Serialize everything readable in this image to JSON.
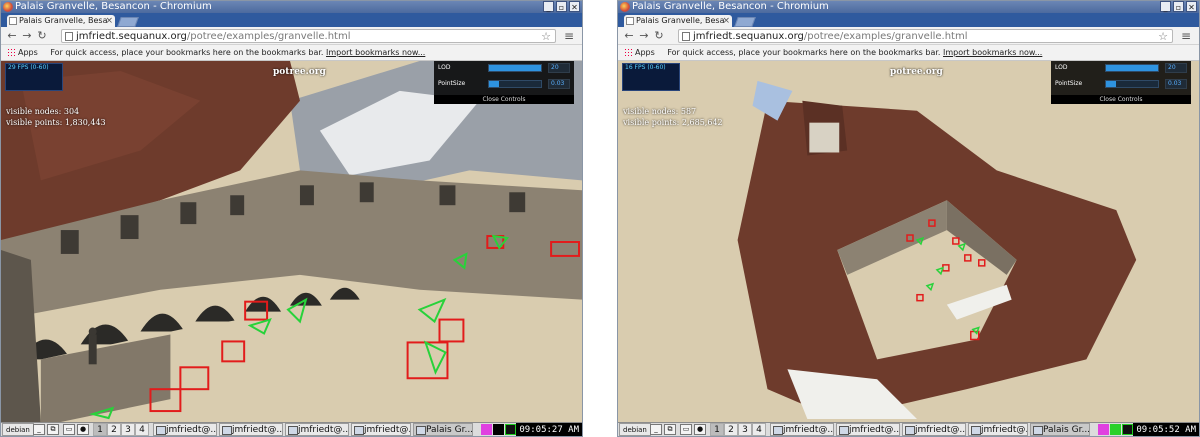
{
  "colors": {
    "titlebar": "#4c6a9e",
    "tabstrip": "#2f5a9e",
    "sky": "#d9ccaf",
    "roof": "#6e3b2c",
    "wall": "#8c8272",
    "frustum_red": "#e21b1b",
    "frustum_green": "#28d23a",
    "slider_fill": "#2e93e0"
  },
  "left": {
    "window_title": "Palais Granvelle, Besancon - Chromium",
    "tab_title": "Palais Granvelle, Besa",
    "url_host": "jmfriedt.sequanux.org",
    "url_path": "/potree/examples/granvelle.html",
    "bookmarks": {
      "apps": "Apps",
      "hint": "For quick access, place your bookmarks here on the bookmarks bar.",
      "import": "Import bookmarks now..."
    },
    "fps": "29 FPS (0-60)",
    "brand": "potree.org",
    "visible_nodes": "visible nodes: 304",
    "visible_points": "visible points: 1,830,443",
    "controls": {
      "lod_label": "LOD",
      "lod_value": "20",
      "lod_level": 1.0,
      "pointsize_label": "PointSize",
      "pointsize_value": "0.03",
      "pointsize_level": 0.2,
      "close": "Close Controls"
    },
    "taskbar": {
      "start": "debian",
      "ws": [
        "1",
        "2",
        "3",
        "4"
      ],
      "tasks": [
        "jmfriedt@...",
        "jmfriedt@...",
        "jmfriedt@...",
        "jmfriedt@...",
        "Palais Gr..."
      ],
      "clock": "09:05:27 AM"
    }
  },
  "right": {
    "window_title": "Palais Granvelle, Besancon - Chromium",
    "tab_title": "Palais Granvelle, Besa",
    "url_host": "jmfriedt.sequanux.org",
    "url_path": "/potree/examples/granvelle.html",
    "bookmarks": {
      "apps": "Apps",
      "hint": "For quick access, place your bookmarks here on the bookmarks bar.",
      "import": "Import bookmarks now..."
    },
    "fps": "16 FPS (0-60)",
    "brand": "potree.org",
    "visible_nodes": "visible nodes: 587",
    "visible_points": "visible points: 2,685,642",
    "controls": {
      "lod_label": "LOD",
      "lod_value": "20",
      "lod_level": 1.0,
      "pointsize_label": "PointSize",
      "pointsize_value": "0.03",
      "pointsize_level": 0.2,
      "close": "Close Controls"
    },
    "taskbar": {
      "start": "debian",
      "ws": [
        "1",
        "2",
        "3",
        "4"
      ],
      "tasks": [
        "jmfriedt@...",
        "jmfriedt@...",
        "jmfriedt@...",
        "jmfriedt@...",
        "Palais Gr..."
      ],
      "clock": "09:05:52 AM"
    }
  }
}
